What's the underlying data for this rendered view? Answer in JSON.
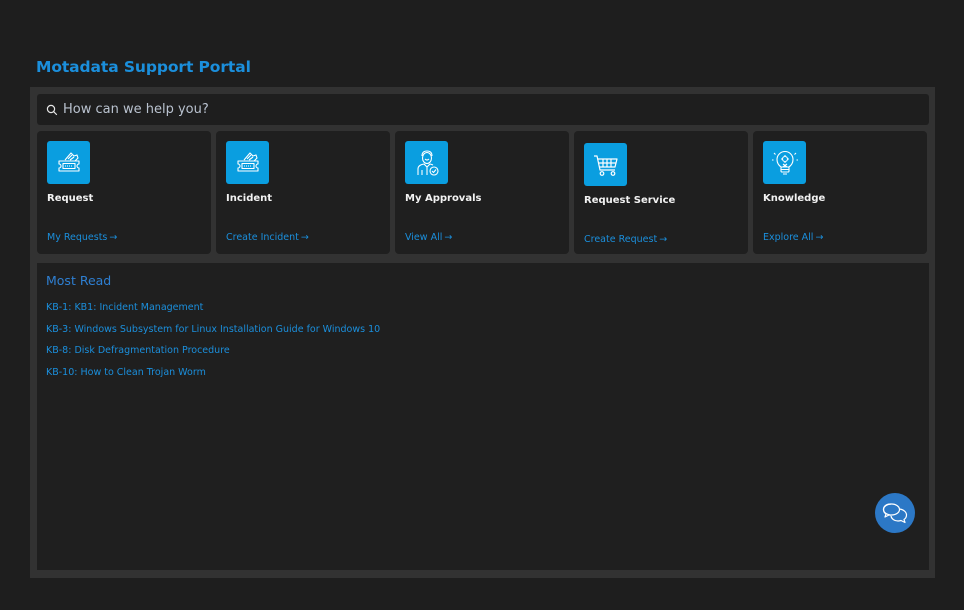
{
  "header": {
    "title": "Motadata Support Portal"
  },
  "search": {
    "placeholder": "How can we help you?",
    "value": "",
    "icon": "search-icon"
  },
  "cards": [
    {
      "title": "Request",
      "link": "My Requests",
      "icon": "ticket-icon"
    },
    {
      "title": "Incident",
      "link": "Create Incident",
      "icon": "ticket-icon"
    },
    {
      "title": "My Approvals",
      "link": "View All",
      "icon": "approver-person-icon"
    },
    {
      "title": "Request Service",
      "link": "Create Request",
      "icon": "shopping-cart-icon"
    },
    {
      "title": "Knowledge",
      "link": "Explore All",
      "icon": "lightbulb-icon"
    }
  ],
  "arrow": "→",
  "most_read": {
    "title": "Most Read",
    "items": [
      "KB-1: KB1: Incident Management",
      "KB-3: Windows Subsystem for Linux Installation Guide for Windows 10",
      "KB-8: Disk Defragmentation Procedure",
      "KB-10: How to Clean Trojan Worm"
    ]
  },
  "chat": {
    "icon": "chat-bubbles-icon"
  },
  "colors": {
    "background": "#1e1e1e",
    "container": "#323232",
    "panel": "#1f1f1f",
    "accent": "#1b8fdc",
    "icon_tile": "#0a9ee0",
    "chat_button": "#2c78c6"
  }
}
